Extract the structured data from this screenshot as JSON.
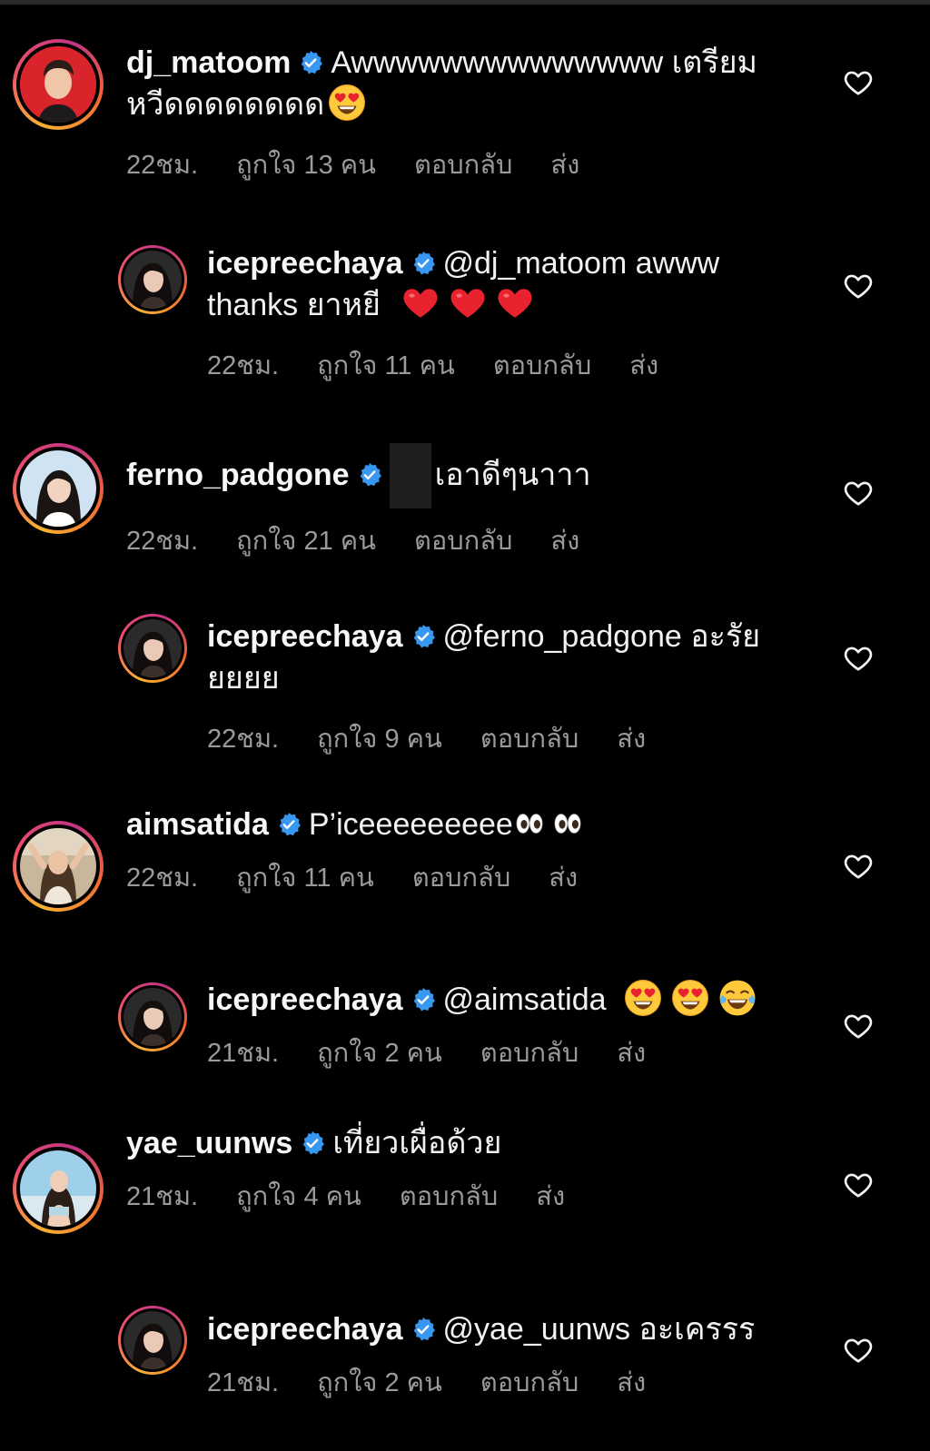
{
  "comments": [
    {
      "username": "dj_matoom",
      "text": "Awwwwwwwwwwwwww เตรียมหวีดดดดดดดด",
      "emoji": [
        "heart-eyes"
      ],
      "time": "22ชม.",
      "likes": "ถูกใจ 13 คน",
      "reply": "ตอบกลับ",
      "send": "ส่ง"
    },
    {
      "username": "icepreechaya",
      "text": "@dj_matoom awww thanks ยาหยี",
      "emoji": [
        "red-heart",
        "red-heart",
        "red-heart"
      ],
      "time": "22ชม.",
      "likes": "ถูกใจ 11 คน",
      "reply": "ตอบกลับ",
      "send": "ส่ง"
    },
    {
      "username": "ferno_padgone",
      "text": "เอาดีๆนาาา",
      "emoji": [],
      "time": "22ชม.",
      "likes": "ถูกใจ 21 คน",
      "reply": "ตอบกลับ",
      "send": "ส่ง"
    },
    {
      "username": "icepreechaya",
      "text": "@ferno_padgone อะรัยยยยย",
      "emoji": [],
      "time": "22ชม.",
      "likes": "ถูกใจ 9 คน",
      "reply": "ตอบกลับ",
      "send": "ส่ง"
    },
    {
      "username": "aimsatida",
      "text": "P’iceeeeeeeee",
      "emoji": [
        "eyes",
        "eyes"
      ],
      "time": "22ชม.",
      "likes": "ถูกใจ 11 คน",
      "reply": "ตอบกลับ",
      "send": "ส่ง"
    },
    {
      "username": "icepreechaya",
      "text": "@aimsatida",
      "emoji": [
        "heart-eyes",
        "heart-eyes",
        "tears-of-joy"
      ],
      "time": "21ชม.",
      "likes": "ถูกใจ 2 คน",
      "reply": "ตอบกลับ",
      "send": "ส่ง"
    },
    {
      "username": "yae_uunws",
      "text": "เที่ยวเผื่อด้วย",
      "emoji": [],
      "time": "21ชม.",
      "likes": "ถูกใจ 4 คน",
      "reply": "ตอบกลับ",
      "send": "ส่ง"
    },
    {
      "username": "icepreechaya",
      "text": "@yae_uunws อะเครรร",
      "emoji": [],
      "time": "21ชม.",
      "likes": "ถูกใจ 2 คน",
      "reply": "ตอบกลับ",
      "send": "ส่ง"
    }
  ],
  "icons": {
    "verified": "verified-badge-icon",
    "like": "heart-outline-icon"
  },
  "colors": {
    "background": "#000000",
    "text": "#f5f5f5",
    "meta": "#9a9a9a",
    "verified": "#3897f0"
  }
}
